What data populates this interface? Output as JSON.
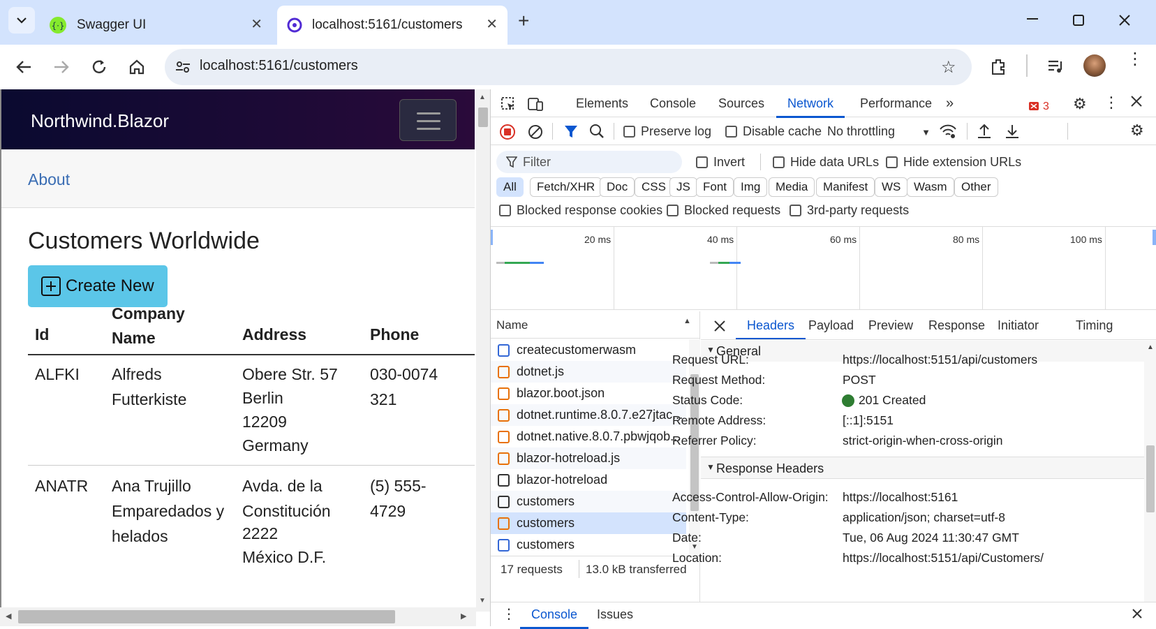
{
  "browser": {
    "tabs": [
      {
        "title": "Swagger UI",
        "active": false
      },
      {
        "title": "localhost:5161/customers",
        "active": true
      }
    ],
    "new_tab": "+",
    "url": "localhost:5161/customers"
  },
  "app": {
    "brand": "Northwind.Blazor",
    "nav_link": "About",
    "page_title": "Customers Worldwide",
    "create_button": "Create New",
    "table": {
      "headers": [
        "Id",
        "Company Name",
        "Address",
        "Phone"
      ],
      "rows": [
        {
          "id": "ALFKI",
          "company": "Alfreds Futterkiste",
          "address": [
            "Obere Str. 57",
            "Berlin",
            "12209",
            "Germany"
          ],
          "phone": "030-0074321"
        },
        {
          "id": "ANATR",
          "company": "Ana Trujillo Emparedados y helados",
          "address": [
            "Avda. de la Constitución",
            "2222",
            "México D.F."
          ],
          "phone": "(5) 555-4729"
        }
      ]
    }
  },
  "devtools": {
    "tabs": [
      "Elements",
      "Console",
      "Sources",
      "Network",
      "Performance"
    ],
    "active_tab": "Network",
    "issues_count": "3",
    "toolbar": {
      "preserve_log": "Preserve log",
      "disable_cache": "Disable cache",
      "throttling": "No throttling"
    },
    "filter": {
      "placeholder": "Filter",
      "invert": "Invert",
      "hide_data_urls": "Hide data URLs",
      "hide_extension_urls": "Hide extension URLs"
    },
    "type_filters": [
      "All",
      "Fetch/XHR",
      "Doc",
      "CSS",
      "JS",
      "Font",
      "Img",
      "Media",
      "Manifest",
      "WS",
      "Wasm",
      "Other"
    ],
    "active_type_filter": "All",
    "extra_filters": [
      "Blocked response cookies",
      "Blocked requests",
      "3rd-party requests"
    ],
    "timeline_ticks": [
      "20 ms",
      "40 ms",
      "60 ms",
      "80 ms",
      "100 ms"
    ],
    "requests_header": "Name",
    "requests": [
      {
        "name": "createcustomerwasm",
        "kind": "doc"
      },
      {
        "name": "dotnet.js",
        "kind": "script"
      },
      {
        "name": "blazor.boot.json",
        "kind": "json"
      },
      {
        "name": "dotnet.runtime.8.0.7.e27jtac...",
        "kind": "script"
      },
      {
        "name": "dotnet.native.8.0.7.pbwjqob...",
        "kind": "script"
      },
      {
        "name": "blazor-hotreload.js",
        "kind": "script"
      },
      {
        "name": "blazor-hotreload",
        "kind": "plain"
      },
      {
        "name": "customers",
        "kind": "plain"
      },
      {
        "name": "customers",
        "kind": "json",
        "selected": true
      },
      {
        "name": "customers",
        "kind": "doc"
      }
    ],
    "summary": {
      "requests": "17 requests",
      "transferred": "13.0 kB transferred"
    },
    "detail_tabs": [
      "Headers",
      "Payload",
      "Preview",
      "Response",
      "Initiator",
      "Timing"
    ],
    "active_detail_tab": "Headers",
    "general": {
      "section": "General",
      "items": [
        {
          "label": "Request URL:",
          "value": "https://localhost:5151/api/customers"
        },
        {
          "label": "Request Method:",
          "value": "POST"
        },
        {
          "label": "Status Code:",
          "value": "201 Created"
        },
        {
          "label": "Remote Address:",
          "value": "[::1]:5151"
        },
        {
          "label": "Referrer Policy:",
          "value": "strict-origin-when-cross-origin"
        }
      ]
    },
    "response_headers": {
      "section": "Response Headers",
      "items": [
        {
          "label": "Access-Control-Allow-Origin:",
          "value": "https://localhost:5161"
        },
        {
          "label": "Content-Type:",
          "value": "application/json; charset=utf-8"
        },
        {
          "label": "Date:",
          "value": "Tue, 06 Aug 2024 11:30:47 GMT"
        },
        {
          "label": "Location:",
          "value": "https://localhost:5151/api/Customers/"
        }
      ]
    },
    "drawer_tabs": [
      "Console",
      "Issues"
    ],
    "active_drawer_tab": "Console"
  },
  "colors": {
    "accent": "#0b57d0",
    "status_ok": "#2e7d32",
    "record_red": "#d93025",
    "create_button": "#5bc6e8"
  }
}
